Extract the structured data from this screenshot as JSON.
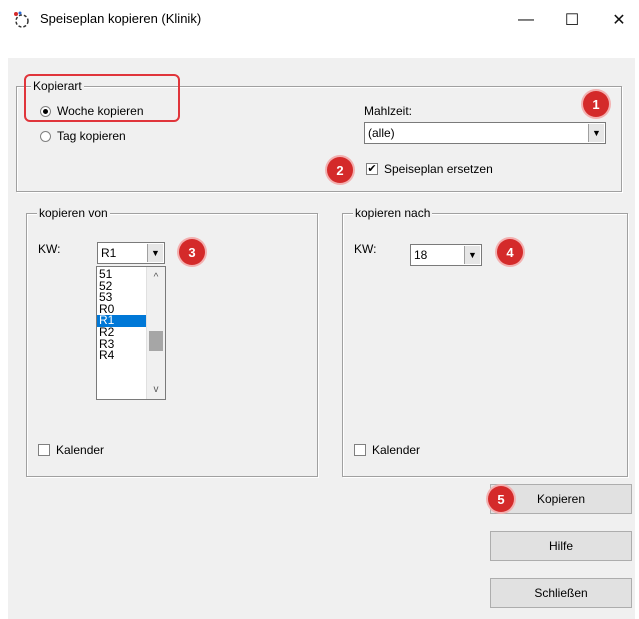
{
  "window": {
    "title": "Speiseplan kopieren (Klinik)",
    "minimize_glyph": "—",
    "maximize_glyph": "☐",
    "close_glyph": "✕"
  },
  "kopierart": {
    "label": "Kopierart",
    "woche_label": "Woche kopieren",
    "tag_label": "Tag kopieren",
    "selected": "woche"
  },
  "mahlzeit": {
    "label": "Mahlzeit:",
    "value": "(alle)"
  },
  "speiseplan_ersetzen": {
    "label": "Speiseplan ersetzen",
    "checked": true
  },
  "kopieren_von": {
    "label": "kopieren von",
    "kw_label": "KW:",
    "kw_value": "R1",
    "list_items": [
      "51",
      "52",
      "53",
      "R0",
      "R1",
      "R2",
      "R3",
      "R4"
    ],
    "selected_index": 4,
    "kalender_label": "Kalender"
  },
  "kopieren_nach": {
    "label": "kopieren nach",
    "kw_label": "KW:",
    "kw_value": "18",
    "kalender_label": "Kalender"
  },
  "buttons": {
    "kopieren": "Kopieren",
    "hilfe": "Hilfe",
    "schliessen": "Schließen"
  },
  "badges": [
    "1",
    "2",
    "3",
    "4",
    "5"
  ],
  "colors": {
    "badge": "#d42a2a",
    "highlight": "#e0353b",
    "selection": "#0078d7"
  }
}
